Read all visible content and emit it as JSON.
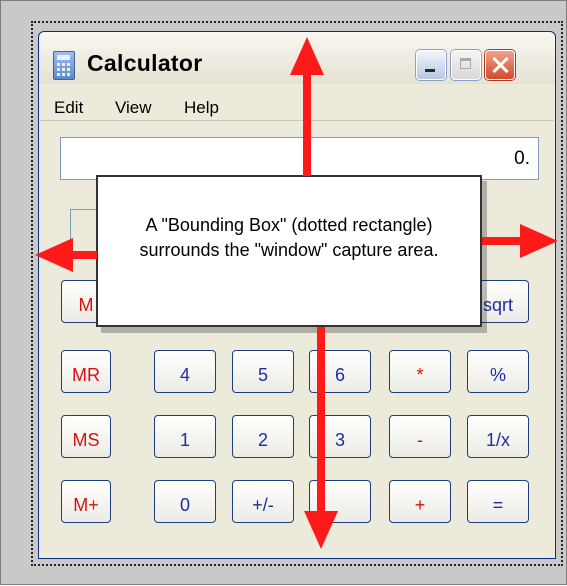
{
  "window": {
    "title": "Calculator",
    "icon": "calculator-icon",
    "controls": [
      "minimize-icon",
      "maximize-icon",
      "close-icon"
    ]
  },
  "menu": {
    "items": [
      "Edit",
      "View",
      "Help"
    ]
  },
  "display": {
    "value": "0."
  },
  "buttons": {
    "rows": [
      [
        "M",
        "",
        "",
        "",
        "",
        "sqrt"
      ],
      [
        "MR",
        "4",
        "5",
        "6",
        "*",
        "%"
      ],
      [
        "MS",
        "1",
        "2",
        "3",
        "-",
        "1/x"
      ],
      [
        "M+",
        "0",
        "+/-",
        "",
        "+",
        "="
      ]
    ]
  },
  "callout": {
    "text": "A \"Bounding Box\" (dotted rectangle) surrounds the \"window\" capture area."
  },
  "colors": {
    "arrow": "#ff1a1a",
    "memory_keys": "#d9100f",
    "number_keys": "#1d2f9f"
  }
}
